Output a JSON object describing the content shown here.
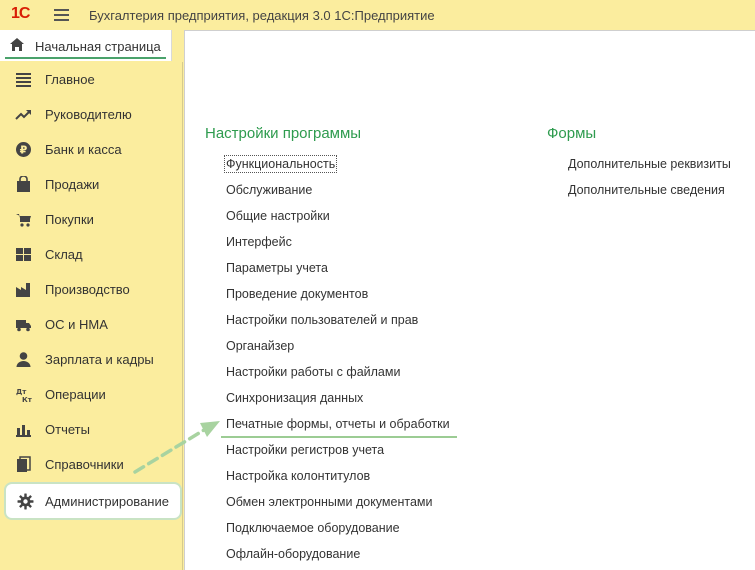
{
  "app": {
    "logo": "1С",
    "title": "Бухгалтерия предприятия, редакция 3.0 1С:Предприятие"
  },
  "home_tab": {
    "label": "Начальная страница"
  },
  "sidebar": {
    "items": [
      {
        "label": "Главное",
        "icon": "menu-list-icon"
      },
      {
        "label": "Руководителю",
        "icon": "trend-up-icon"
      },
      {
        "label": "Банк и касса",
        "icon": "ruble-coin-icon"
      },
      {
        "label": "Продажи",
        "icon": "shopping-bag-icon"
      },
      {
        "label": "Покупки",
        "icon": "cart-icon"
      },
      {
        "label": "Склад",
        "icon": "warehouse-grid-icon"
      },
      {
        "label": "Производство",
        "icon": "factory-icon"
      },
      {
        "label": "ОС и НМА",
        "icon": "truck-icon"
      },
      {
        "label": "Зарплата и кадры",
        "icon": "person-icon"
      },
      {
        "label": "Операции",
        "icon": "debit-credit-icon"
      },
      {
        "label": "Отчеты",
        "icon": "bar-chart-icon"
      },
      {
        "label": "Справочники",
        "icon": "books-icon"
      },
      {
        "label": "Администрирование",
        "icon": "gear-icon",
        "active": true
      }
    ]
  },
  "content": {
    "settings_group": {
      "title": "Настройки программы",
      "links": [
        "Функциональность",
        "Обслуживание",
        "Общие настройки",
        "Интерфейс",
        "Параметры учета",
        "Проведение документов",
        "Настройки пользователей и прав",
        "Органайзер",
        "Настройки работы с файлами",
        "Синхронизация данных",
        "Печатные формы, отчеты и обработки",
        "Настройки регистров учета",
        "Настройка колонтитулов",
        "Обмен электронными документами",
        "Подключаемое оборудование",
        "Офлайн-оборудование"
      ]
    },
    "forms_group": {
      "title": "Формы",
      "links": [
        "Дополнительные реквизиты",
        "Дополнительные сведения"
      ]
    }
  },
  "colors": {
    "sidebar_bg": "#fbed9e",
    "group_title": "#2e9b4e",
    "highlight": "#9ccc94",
    "logo": "#d81e05"
  }
}
